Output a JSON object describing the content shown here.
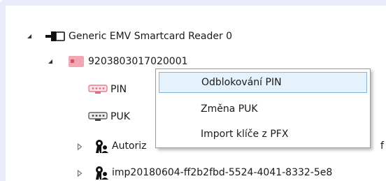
{
  "tree": {
    "reader": {
      "label": "Generic EMV Smartcard Reader 0",
      "icon": "card-reader-icon",
      "expander": "expanded"
    },
    "card": {
      "label": "9203803017020001",
      "icon": "smartcard-icon",
      "expander": "expanded",
      "icon_color": "#f2a7b4"
    },
    "pin": {
      "label": "PIN",
      "icon": "pin-keypad-icon",
      "icon_color": "#e06b7e"
    },
    "puk": {
      "label": "PUK",
      "icon": "puk-keypad-icon"
    },
    "cert1": {
      "label": "Autoriz",
      "label_tail": "f",
      "icon": "key-person-icon",
      "expander": "collapsed"
    },
    "cert2": {
      "label": "imp20180604-ff2b2fbd-5524-4041-8332-5e8",
      "icon": "key-person-icon",
      "expander": "collapsed"
    }
  },
  "context_menu": {
    "items": [
      {
        "label": "Odblokování PIN",
        "highlighted": true
      },
      {
        "label": "Změna PUK",
        "highlighted": false
      },
      {
        "label": "Import klíče z PFX",
        "highlighted": false
      }
    ]
  },
  "colors": {
    "frame": "#e9ebf8",
    "menu_highlight": "#e5f1fb",
    "menu_highlight_border": "#7fb4e3"
  }
}
